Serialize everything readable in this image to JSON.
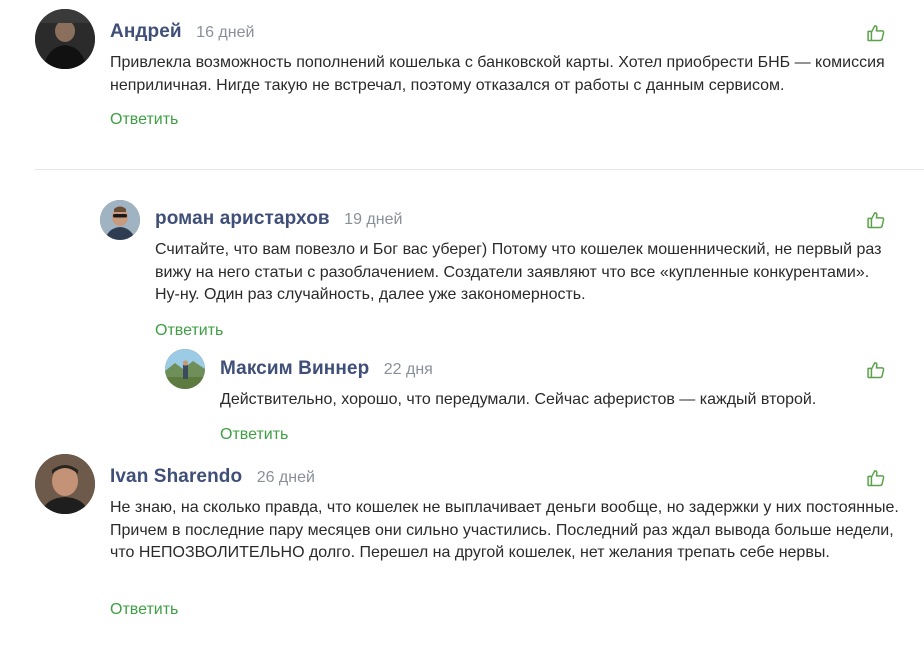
{
  "colors": {
    "name": "#3f4f78",
    "age": "#8a8f99",
    "reply": "#3e9f43",
    "like": "#5aa34a",
    "divider": "#e6e6e6"
  },
  "comments": [
    {
      "author": "Андрей",
      "age": "16 дней",
      "text": "Привлекла возможность пополнений кошелька с банковской карты. Хотел приобрести БНБ — комиссия неприличная. Нигде такую не встречал, поэтому отказался от работы с данным сервисом.",
      "reply_label": "Ответить",
      "like_icon": "thumbs-up-icon"
    },
    {
      "author": "роман аристархов",
      "age": "19 дней",
      "text": "Считайте, что вам повезло и Бог вас уберег) Потому что кошелек мошеннический, не первый раз вижу на него статьи с разоблачением. Создатели заявляют что все «купленные конкурентами». Ну-ну. Один раз случайность, далее уже закономерность.",
      "reply_label": "Ответить",
      "like_icon": "thumbs-up-icon"
    },
    {
      "author": "Максим Виннер",
      "age": "22 дня",
      "text": "Действительно, хорошо, что передумали. Сейчас аферистов — каждый второй.",
      "reply_label": "Ответить",
      "like_icon": "thumbs-up-icon"
    },
    {
      "author": "Ivan Sharendo",
      "age": "26 дней",
      "text": "Не знаю, на сколько правда, что кошелек не выплачивает деньги вообще, но задержки у них постоянные. Причем в последние пару месяцев они сильно участились. Последний раз ждал вывода больше недели, что НЕПОЗВОЛИТЕЛЬНО долго. Перешел на другой кошелек, нет желания трепать себе нервы.",
      "reply_label": "Ответить",
      "like_icon": "thumbs-up-icon"
    }
  ]
}
